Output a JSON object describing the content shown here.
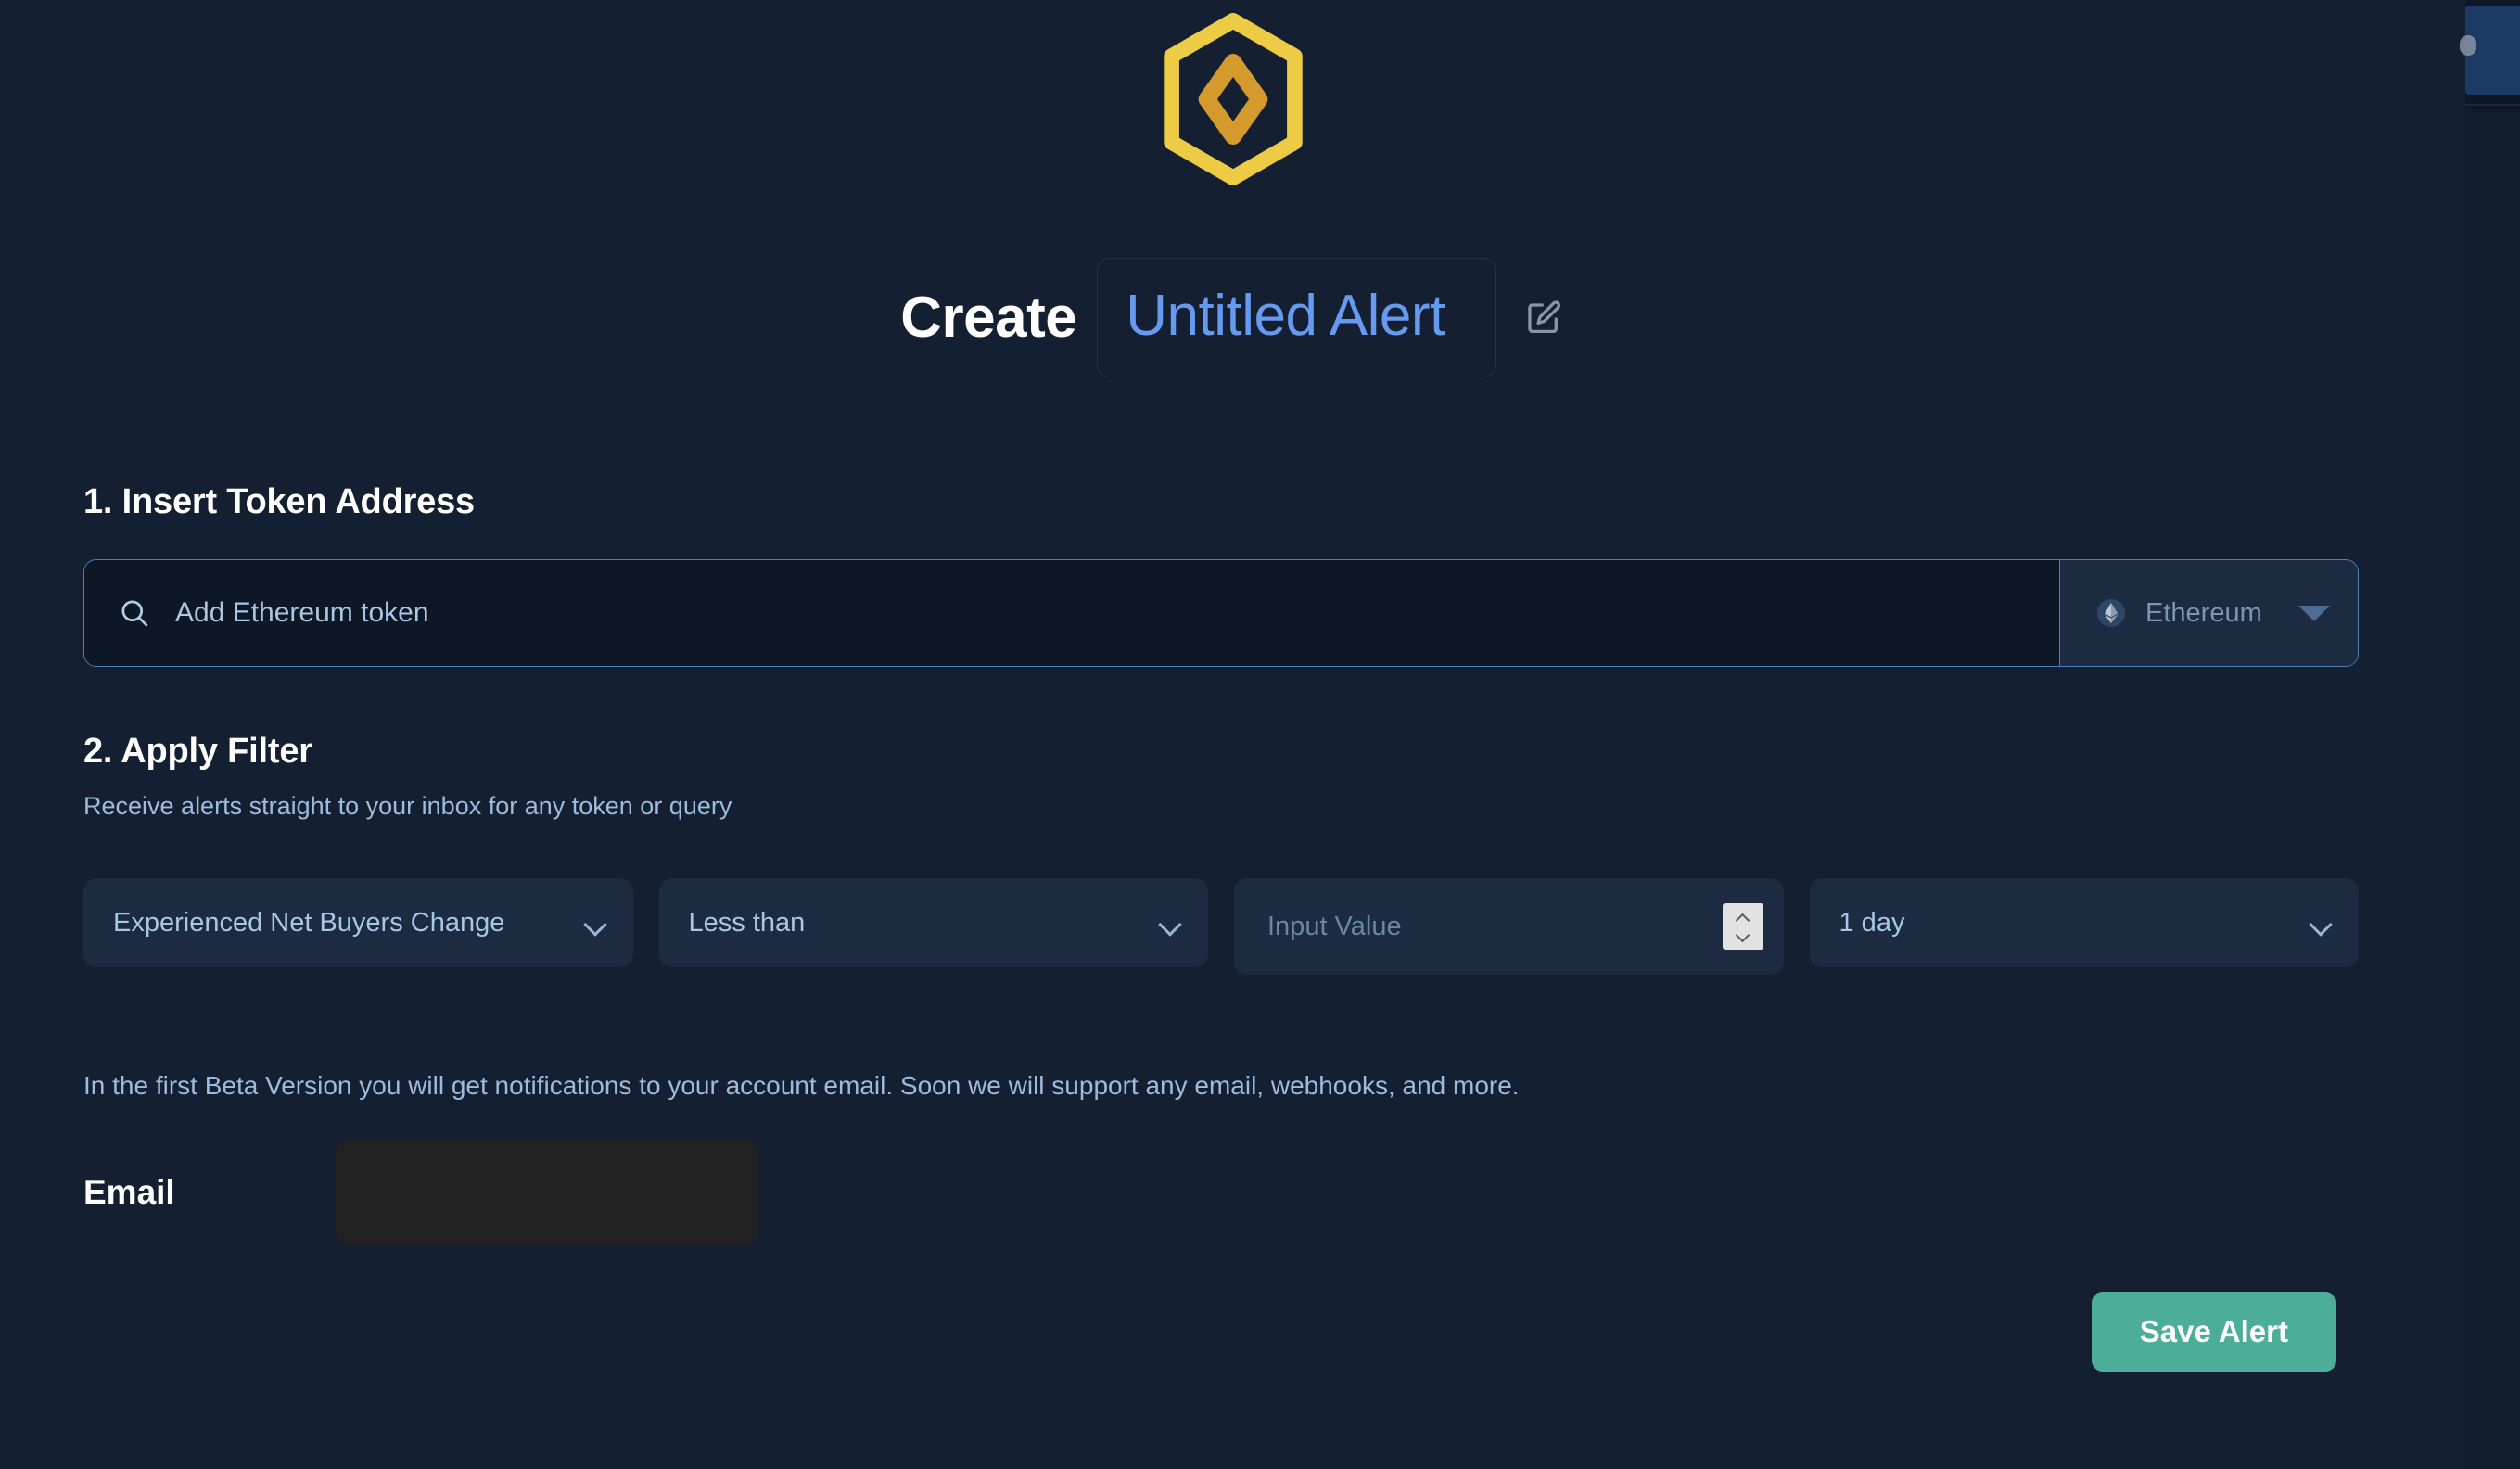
{
  "brand": {
    "logo_icon": "hexagon-diamond-logo",
    "hexagon_color": "#edcb45",
    "diamond_color": "#d49a2c"
  },
  "header": {
    "create_label": "Create",
    "alert_name": "Untitled Alert",
    "alert_name_color": "#6699f0",
    "edit_icon": "edit-pencil-square-icon"
  },
  "step1": {
    "heading": "1. Insert Token Address",
    "search_icon": "search-icon",
    "search_placeholder": "Add Ethereum token",
    "search_value": "",
    "chain_icon": "ethereum-icon",
    "chain_selected": "Ethereum",
    "chain_caret_icon": "caret-down-icon"
  },
  "step2": {
    "heading": "2. Apply Filter",
    "subheading": "Receive alerts straight to your inbox for any token or query",
    "metric_selected": "Experienced Net Buyers Change",
    "metric_caret_icon": "chevron-down-icon",
    "operator_selected": "Less than",
    "operator_caret_icon": "chevron-down-icon",
    "value_placeholder": "Input Value",
    "value_current": "",
    "value_spinner_icon": "number-spinner-icon",
    "period_selected": "1 day",
    "period_caret_icon": "chevron-down-icon"
  },
  "notice": {
    "beta_text": "In the first Beta Version you will get notifications to your account email. Soon we will support any email, webhooks, and more."
  },
  "email": {
    "label": "Email",
    "value": "",
    "placeholder": ""
  },
  "footer": {
    "save_label": "Save Alert",
    "save_color": "#4cae98"
  },
  "colors": {
    "page_background": "#142032",
    "input_background": "#0d1726",
    "field_background": "#1c2b42",
    "accent_border": "#4d7eb5",
    "muted_text": "#9dbbdd"
  }
}
